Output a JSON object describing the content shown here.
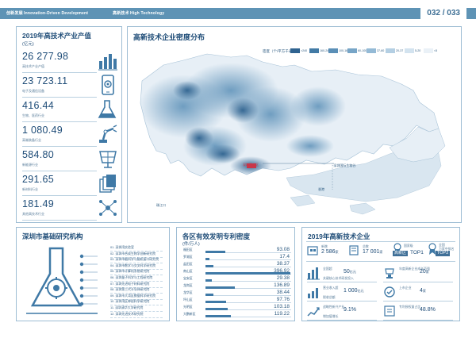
{
  "header": {
    "section_cn": "创新发展",
    "section_en": "Innovation-Driven Development",
    "sub_cn": "高新技术",
    "sub_en": "High Technology",
    "page_number": "032 / 033"
  },
  "output_panel": {
    "title": "2019年高技术产业产值",
    "unit": "(亿元)",
    "items": [
      {
        "value": "26 277.98",
        "label": "高技术产业产值",
        "icon": "bar-chart-icon"
      },
      {
        "value": "23 723.11",
        "label": "电子及通信设备",
        "icon": "smartphone-gear-icon"
      },
      {
        "value": "416.44",
        "label": "生物、医药行业",
        "icon": "lab-flask-icon"
      },
      {
        "value": "1 080.49",
        "label": "高端装备行业",
        "icon": "robot-arm-icon"
      },
      {
        "value": "584.80",
        "label": "新能源行业",
        "icon": "solar-panel-icon"
      },
      {
        "value": "291.65",
        "label": "新材料行业",
        "icon": "material-layers-icon"
      },
      {
        "value": "181.49",
        "label": "其他高技术行业",
        "icon": "network-nodes-icon"
      }
    ]
  },
  "map_panel": {
    "title": "高新技术企业密度分布",
    "legend_title": "密度（个/平方千米）",
    "legend": [
      {
        "label": ">240",
        "color": "#2f6390"
      },
      {
        "label": "160-240",
        "color": "#427aa5"
      },
      {
        "label": "100-160",
        "color": "#5a8fb7"
      },
      {
        "label": "60-100",
        "color": "#77a5c7"
      },
      {
        "label": "37-60",
        "color": "#94bad6"
      },
      {
        "label": "20-37",
        "color": "#b4cfe3"
      },
      {
        "label": "5-20",
        "color": "#d3e3ef"
      },
      {
        "label": "<5",
        "color": "#eaf1f7"
      }
    ],
    "labels": {
      "hk": "香港",
      "marker": "深圳高新区",
      "sub": "·深圳国际生物谷",
      "sea": "珠江口"
    }
  },
  "institutes_panel": {
    "title": "深圳市基础研究机构",
    "items": [
      "01. 深圳湾实验室",
      "02. 深圳市合成生物学创新研究院",
      "03. 深圳市脑科学与脑机接口研究院",
      "04. 深圳市数学与交叉科学研究院",
      "05. 深圳市计算机系统研究院",
      "06. 深圳量子科学与工程研究院",
      "07. 深圳先进电子材料研究院",
      "08. 深圳第三代半导体研究院",
      "09. 深圳市大湾区数据科学研究院",
      "10. 深圳湾区神经科学研究院",
      "11. 深圳清华大学研究院",
      "12. 深圳先进技术研究院"
    ]
  },
  "patent_panel": {
    "title": "各区有效发明专利密度",
    "unit": "(件/万人)",
    "max": 400,
    "items": [
      {
        "name": "福田区",
        "value": 93.08
      },
      {
        "name": "罗湖区",
        "value": 17.4
      },
      {
        "name": "盐田区",
        "value": 38.37
      },
      {
        "name": "南山区",
        "value": 396.92
      },
      {
        "name": "宝安区",
        "value": 29.38
      },
      {
        "name": "龙岗区",
        "value": 136.89
      },
      {
        "name": "龙华区",
        "value": 38.44
      },
      {
        "name": "坪山区",
        "value": 97.76
      },
      {
        "name": "光明区",
        "value": 103.18
      },
      {
        "name": "大鹏新区",
        "value": 119.22
      }
    ]
  },
  "enterprise_panel": {
    "title": "2019年高新技术企业",
    "stats": [
      {
        "value": "2 586",
        "unit": "家",
        "label": "新增"
      },
      {
        "value": "17 001",
        "unit": "家",
        "label": "总数"
      }
    ],
    "rank_labels": [
      {
        "label": "国家级",
        "sub": "高新区",
        "rank": "TOP1"
      },
      {
        "label": "全国",
        "sub": "万家中排名",
        "rank": "TOP2"
      }
    ],
    "rows": [
      {
        "value": "50",
        "unit": "亿元",
        "label": "全国超",
        "sub": "关键核心技术研发投入"
      },
      {
        "value": "20",
        "unit": "家",
        "label": "年度高新企业成长百强",
        "sub": ""
      },
      {
        "value": "1 000",
        "unit": "亿元",
        "label": "营业收入超",
        "sub": "税收总额"
      },
      {
        "value": "4",
        "unit": "家",
        "label": "上市企业",
        "sub": ""
      },
      {
        "value": "9.1%",
        "unit": "",
        "label": "战略性新兴产业",
        "sub": "增加值增长"
      },
      {
        "value": "48.8%",
        "unit": "",
        "label": "专利授权量占比",
        "sub": ""
      }
    ]
  }
}
